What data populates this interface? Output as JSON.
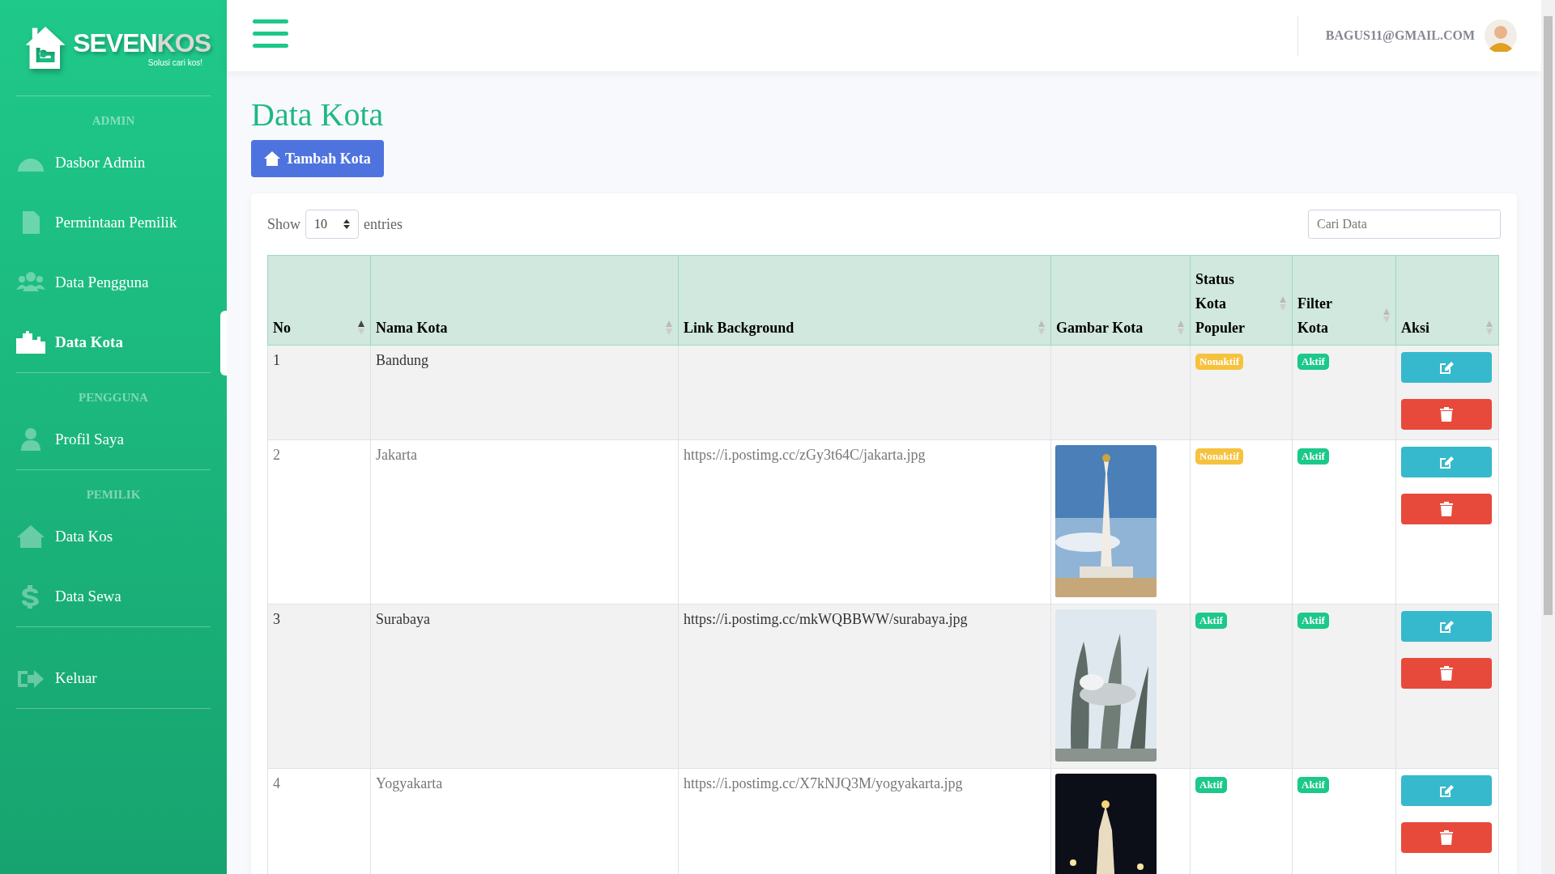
{
  "brand": {
    "primary": "SEVEN",
    "secondary": "KOS",
    "tagline": "Solusi cari kos!"
  },
  "sidebar": {
    "sections": [
      {
        "label": "ADMIN",
        "items": [
          {
            "label": "Dasbor Admin",
            "selected": false
          },
          {
            "label": "Permintaan Pemilik",
            "selected": false
          },
          {
            "label": "Data Pengguna",
            "selected": false
          },
          {
            "label": "Data Kota",
            "selected": true
          }
        ]
      },
      {
        "label": "PENGGUNA",
        "items": [
          {
            "label": "Profil Saya",
            "selected": false
          }
        ]
      },
      {
        "label": "PEMILIK",
        "items": [
          {
            "label": "Data Kos",
            "selected": false
          },
          {
            "label": "Data Sewa",
            "selected": false
          }
        ]
      },
      {
        "items": [
          {
            "label": "Keluar",
            "selected": false
          }
        ]
      }
    ]
  },
  "header": {
    "user_email": "BAGUS11@GMAIL.COM"
  },
  "page": {
    "title": "Data Kota",
    "add_button": "Tambah Kota"
  },
  "table_controls": {
    "show_label": "Show",
    "page_size": "10",
    "entries_label": "entries",
    "search": {
      "placeholder": "Cari Data"
    }
  },
  "table": {
    "columns": [
      {
        "label": "No",
        "sorted": true
      },
      {
        "label": "Nama Kota",
        "sorted": false
      },
      {
        "label": "Link Background",
        "sorted": false
      },
      {
        "label": "Gambar Kota",
        "sorted": false
      },
      {
        "label": "Status Kota Populer",
        "sorted": false
      },
      {
        "label": "Filter Kota",
        "sorted": false
      },
      {
        "label": "Aksi",
        "sorted": false
      }
    ],
    "rows": [
      {
        "no": "1",
        "name": "Bandung",
        "link": null,
        "image": null,
        "popular": {
          "label": "Nonaktif",
          "active": false
        },
        "filter": {
          "label": "Aktif",
          "active": true
        }
      },
      {
        "no": "2",
        "name": "Jakarta",
        "link": "https://i.postimg.cc/zGy3t64C/jakarta.jpg",
        "popular": {
          "label": "Nonaktif",
          "active": false
        },
        "filter": {
          "label": "Aktif",
          "active": true
        }
      },
      {
        "no": "3",
        "name": "Surabaya",
        "link": "https://i.postimg.cc/mkWQBBWW/surabaya.jpg",
        "popular": {
          "label": "Aktif",
          "active": true
        },
        "filter": {
          "label": "Aktif",
          "active": true
        }
      },
      {
        "no": "4",
        "name": "Yogyakarta",
        "link": "https://i.postimg.cc/X7kNJQ3M/yogyakarta.jpg",
        "popular": {
          "label": "Aktif",
          "active": true
        },
        "filter": {
          "label": "Aktif",
          "active": true
        }
      }
    ]
  }
}
